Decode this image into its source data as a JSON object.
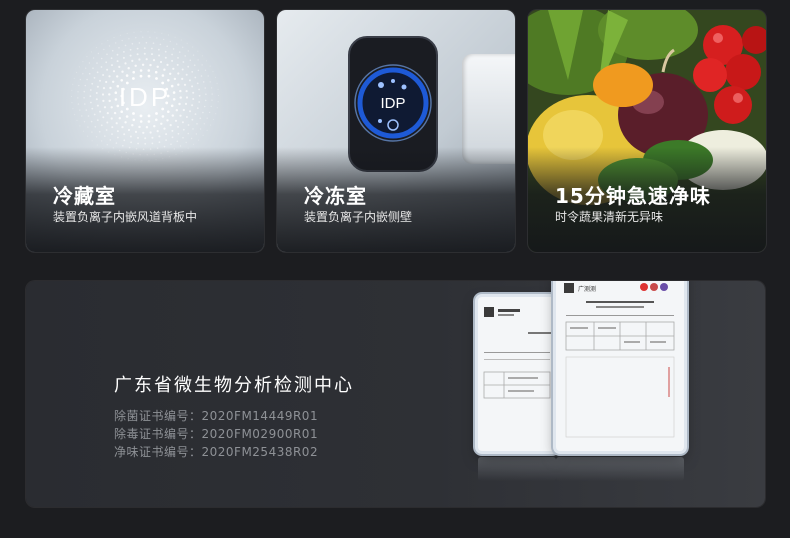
{
  "cards": [
    {
      "title": "冷藏室",
      "subtitle": "装置负离子内嵌风道背板中",
      "badge_text": "IDP"
    },
    {
      "title": "冷冻室",
      "subtitle": "装置负离子内嵌侧壁",
      "badge_text": "IDP"
    },
    {
      "title": "15分钟急速净味",
      "subtitle": "时令蔬果清新无异味"
    }
  ],
  "certification": {
    "title": "广东省微生物分析检测中心",
    "lines": [
      "除菌证书编号：2020FM14449R01",
      "除毒证书编号：2020FM02900R01",
      "净味证书编号：2020FM25438R02"
    ],
    "doc_logo": "广测测"
  },
  "colors": {
    "background": "#1c1d20",
    "badge_ring": "#1e5ad6",
    "badge_dark": "#1a1c22"
  }
}
